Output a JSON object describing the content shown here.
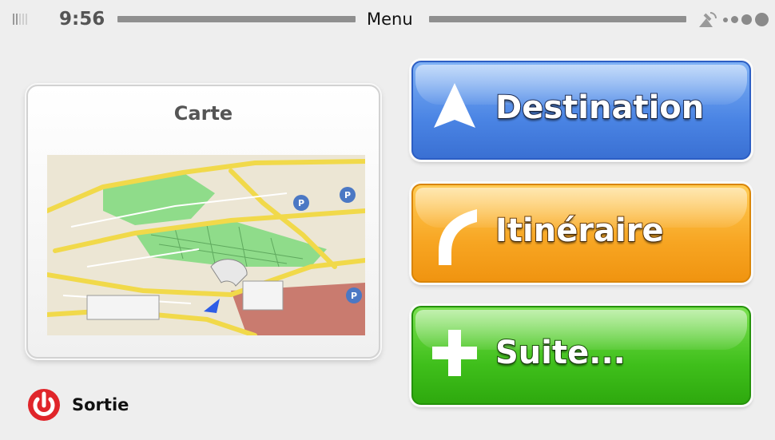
{
  "status_bar": {
    "time": "9:56",
    "title": "Menu",
    "icons": [
      "signal-strength-icon",
      "gps-satellite-icon",
      "battery-dots-icon"
    ]
  },
  "map_card": {
    "title": "Carte"
  },
  "buttons": {
    "destination": {
      "label": "Destination",
      "icon": "navigation-arrow-icon",
      "color": "#4a84e4"
    },
    "itinerary": {
      "label": "Itinéraire",
      "icon": "route-curve-icon",
      "color": "#f7a522"
    },
    "more": {
      "label": "Suite...",
      "icon": "plus-icon",
      "color": "#3fbf1b"
    }
  },
  "exit": {
    "label": "Sortie",
    "icon": "power-icon",
    "color": "#e0252a"
  }
}
